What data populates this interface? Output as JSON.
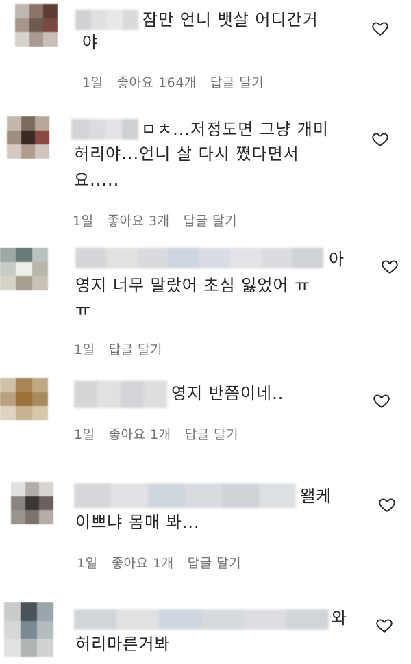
{
  "comments": [
    {
      "lines": [
        "잠만 언니 뱃살 어디간거",
        "야"
      ],
      "time": "1일",
      "likes": "좋아요 164개",
      "reply": "답글 달기",
      "avatar_colors": [
        "#bfb8b0",
        "#8c7466",
        "#5e3b33",
        "#a6968c",
        "#6e5a50",
        "#7a4a40",
        "#d7d2cc",
        "#a89a92",
        "#c9bfb8"
      ],
      "blur_colors": [
        "#cfd1d4",
        "#dfe0e2",
        "#e7e8ea",
        "#d8dadc"
      ]
    },
    {
      "lines": [
        "ㅁㅊ...저정도면 그냥 개미",
        "허리야...언니 살 다시 쪘다면서",
        "요....."
      ],
      "time": "1일",
      "likes": "좋아요 3개",
      "reply": "답글 달기",
      "avatar_colors": [
        "#c4b8ae",
        "#7e6a5c",
        "#b8a89a",
        "#a18e80",
        "#3a2a24",
        "#8a4a40",
        "#d4cac2",
        "#b09c8e",
        "#cfc5bd"
      ],
      "blur_colors": [
        "#d2d4d8",
        "#dadcdf",
        "#e2e3e6",
        "#cdd0d4"
      ]
    },
    {
      "lines": [
        "아",
        "영지 너무 말랐어 초심 잃었어 ㅠ",
        "ㅠ"
      ],
      "time": "1일",
      "likes": "",
      "reply": "답글 달기",
      "avatar_colors": [
        "#9ea8a6",
        "#6a7a78",
        "#b8c2c0",
        "#c7ccc4",
        "#f0eee8",
        "#b9b6aa",
        "#d6d2c8",
        "#a5a090",
        "#c8c2b6"
      ],
      "blur_colors": [
        "#d3d5d8",
        "#e0e1e3",
        "#d8dadd",
        "#cdd5df",
        "#d9dde3",
        "#e1e3e6",
        "#dadce0",
        "#cfd2d6"
      ]
    },
    {
      "lines": [
        "영지 반쯤이네.."
      ],
      "time": "1일",
      "likes": "좋아요 1개",
      "reply": "답글 달기",
      "avatar_colors": [
        "#cfc0a8",
        "#a88456",
        "#c2a882",
        "#b8a080",
        "#9a7038",
        "#a88a5c",
        "#e0d4c0",
        "#c8b490",
        "#d8c8aa"
      ],
      "blur_colors": [
        "#d5d6d8",
        "#e0e1e3",
        "#d2d4d7",
        "#dcdee0"
      ]
    },
    {
      "lines": [
        "왤케",
        "이쁘냐 몸매 봐..."
      ],
      "time": "1일",
      "likes": "좋아요 1개",
      "reply": "답글 달기",
      "avatar_colors": [
        "#e2e0de",
        "#b2aca8",
        "#d8d4d0",
        "#8a8480",
        "#3a3634",
        "#6a6260",
        "#9a948e",
        "#7a726c",
        "#b4aca6"
      ],
      "blur_colors": [
        "#d5d7da",
        "#e0e2e5",
        "#d0d6de",
        "#d8dbe0",
        "#cfd3d8",
        "#dde0e3"
      ]
    },
    {
      "lines": [
        "와",
        "허리마른거봐"
      ],
      "time": "",
      "likes": "",
      "reply": "",
      "avatar_colors": [
        "#c8cccc",
        "#4a5458",
        "#9aa6aa",
        "#d6d8d8",
        "#7a8a90",
        "#b4bcbe",
        "#e0e2e0",
        "#b0b4b4",
        "#d0d2d0"
      ],
      "blur_colors": [
        "#d2d5d8",
        "#dfe1e3",
        "#cdd6df",
        "#d6dade",
        "#dcdee1",
        "#d1d4d8"
      ]
    }
  ]
}
